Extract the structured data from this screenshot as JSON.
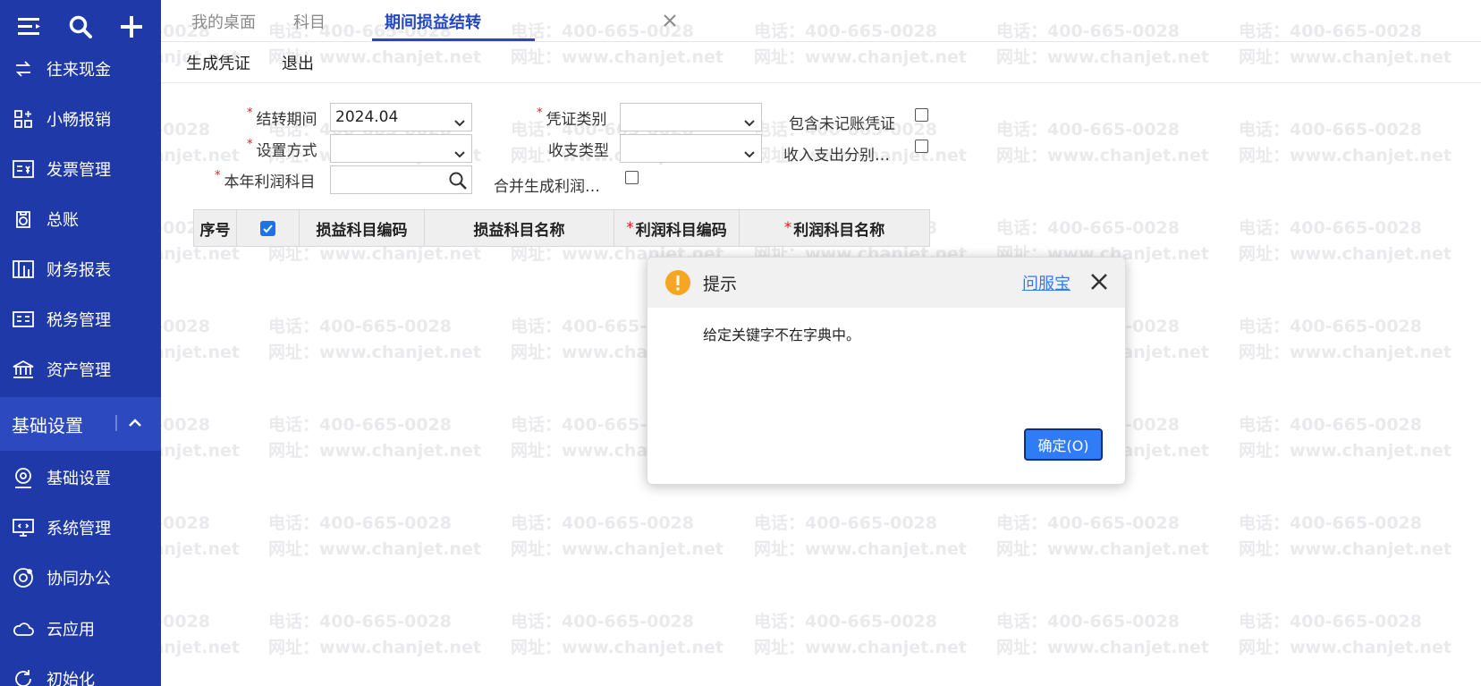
{
  "sidebar": {
    "top_icons": [
      "menu-icon",
      "search-icon",
      "plus-icon"
    ],
    "items": [
      {
        "label": "往来现金",
        "icon": "transfer-icon"
      },
      {
        "label": "小畅报销",
        "icon": "reimburse-icon"
      },
      {
        "label": "发票管理",
        "icon": "invoice-icon"
      },
      {
        "label": "总账",
        "icon": "ledger-icon"
      },
      {
        "label": "财务报表",
        "icon": "report-icon"
      },
      {
        "label": "税务管理",
        "icon": "tax-icon"
      },
      {
        "label": "资产管理",
        "icon": "asset-icon"
      }
    ],
    "section": {
      "label": "基础设置",
      "expanded": true
    },
    "section_items": [
      {
        "label": "基础设置",
        "icon": "settings-icon"
      },
      {
        "label": "系统管理",
        "icon": "system-icon"
      },
      {
        "label": "协同办公",
        "icon": "collab-icon"
      },
      {
        "label": "云应用",
        "icon": "cloud-icon"
      },
      {
        "label": "初始化",
        "icon": "init-icon"
      }
    ]
  },
  "tabs": [
    {
      "label": "我的桌面",
      "active": false
    },
    {
      "label": "科目",
      "active": false
    },
    {
      "label": "期间损益结转",
      "active": true
    }
  ],
  "toolbar": {
    "generate_label": "生成凭证",
    "exit_label": "退出"
  },
  "form": {
    "period_label": "结转期间",
    "period_value": "2024.04",
    "voucher_type_label": "凭证类别",
    "voucher_type_value": "",
    "include_unposted_label": "包含未记账凭证",
    "method_label": "设置方式",
    "method_value": "",
    "income_type_label": "收支类型",
    "income_type_value": "",
    "income_split_label": "收入支出分别…",
    "profit_account_label": "本年利润科目",
    "profit_account_value": "",
    "merge_label": "合并生成利润…"
  },
  "table": {
    "columns": [
      "序号",
      "",
      "损益科目编码",
      "损益科目名称",
      "利润科目编码",
      "利润科目名称"
    ],
    "select_all_checked": true
  },
  "dialog": {
    "title": "提示",
    "help_link": "问服宝",
    "message": "给定关键字不在字典中。",
    "ok_label": "确定(O)"
  },
  "watermark": {
    "phone": "电话：400-665-0028",
    "site": "网址：www.chanjet.net"
  },
  "colors": {
    "sidebar": "#1f3aa8",
    "accent": "#2447c7",
    "button": "#2f7cf6",
    "warning": "#f5a623"
  }
}
